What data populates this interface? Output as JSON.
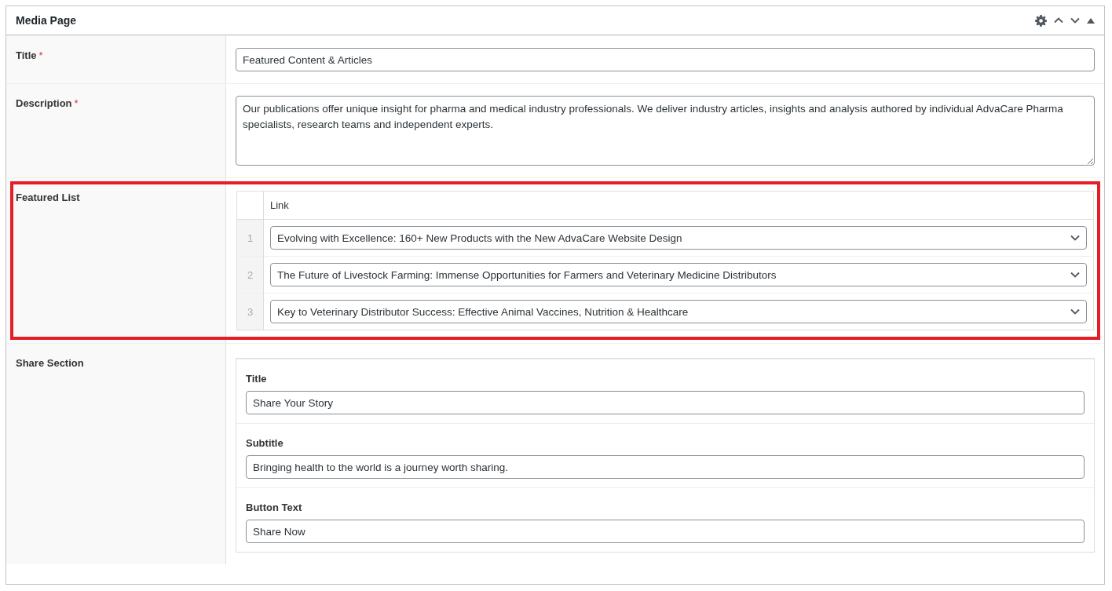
{
  "panel": {
    "title": "Media Page",
    "fields": [
      {
        "kind": "text",
        "label": "Title",
        "required_mark": "*",
        "value": "Featured Content & Articles"
      },
      {
        "kind": "textarea",
        "label": "Description",
        "required_mark": "*",
        "value": "Our publications offer unique insight for pharma and medical industry professionals. We deliver industry articles, insights and analysis authored by individual AdvaCare Pharma specialists, research teams and independent experts."
      },
      {
        "kind": "repeater",
        "label": "Featured List",
        "highlighted": true,
        "column": "Link",
        "rows": [
          {
            "index": "1",
            "value": "Evolving with Excellence: 160+ New Products with the New AdvaCare Website Design"
          },
          {
            "index": "2",
            "value": "The Future of Livestock Farming: Immense Opportunities for Farmers and Veterinary Medicine Distributors"
          },
          {
            "index": "3",
            "value": "Key to Veterinary Distributor Success: Effective Animal Vaccines, Nutrition & Healthcare"
          }
        ]
      },
      {
        "kind": "group",
        "label": "Share Section",
        "subfields": [
          {
            "label": "Title",
            "value": "Share Your Story"
          },
          {
            "label": "Subtitle",
            "value": "Bringing health to the world is a journey worth sharing."
          },
          {
            "label": "Button Text",
            "value": "Share Now"
          }
        ]
      }
    ]
  }
}
